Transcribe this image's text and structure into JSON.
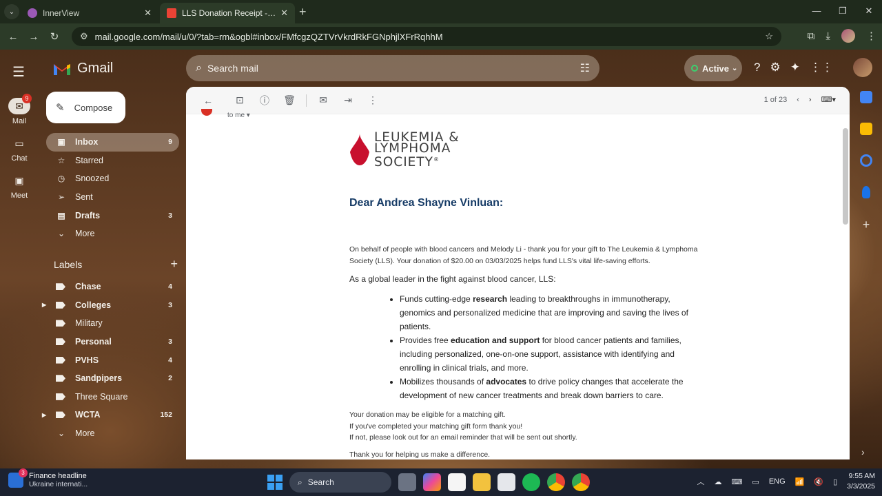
{
  "browser": {
    "tabs": [
      {
        "title": "InnerView"
      },
      {
        "title": "LLS Donation Receipt - andrea.s"
      }
    ],
    "url": "mail.google.com/mail/u/0/?tab=rm&ogbl#inbox/FMfcgzQZTVrVkrdRkFGNphjlXFrRqhhM"
  },
  "gmail": {
    "brand": "Gmail",
    "search_placeholder": "Search mail",
    "status": "Active",
    "rail": [
      {
        "label": "Mail",
        "badge": "9"
      },
      {
        "label": "Chat"
      },
      {
        "label": "Meet"
      }
    ],
    "compose": "Compose",
    "nav": [
      {
        "label": "Inbox",
        "count": "9"
      },
      {
        "label": "Starred",
        "count": ""
      },
      {
        "label": "Snoozed",
        "count": ""
      },
      {
        "label": "Sent",
        "count": ""
      },
      {
        "label": "Drafts",
        "count": "3"
      },
      {
        "label": "More",
        "count": ""
      }
    ],
    "labels_title": "Labels",
    "labels": [
      {
        "label": "Chase",
        "count": "4"
      },
      {
        "label": "Colleges",
        "count": "3"
      },
      {
        "label": "Military",
        "count": ""
      },
      {
        "label": "Personal",
        "count": "3"
      },
      {
        "label": "PVHS",
        "count": "4"
      },
      {
        "label": "Sandpipers",
        "count": "2"
      },
      {
        "label": "Three Square",
        "count": ""
      },
      {
        "label": "WCTA",
        "count": "152"
      },
      {
        "label": "More",
        "count": ""
      }
    ],
    "pager": "1 of 23"
  },
  "email": {
    "to": "to me",
    "org_name": "LEUKEMIA & LYMPHOMA SOCIETY",
    "org_line1": "LEUKEMIA &",
    "org_line2": "LYMPHOMA",
    "org_line3": "SOCIETY",
    "greeting": "Dear Andrea Shayne Vinluan:",
    "intro": "On behalf of people with blood cancers and Melody Li - thank you for your gift to The Leukemia & Lymphoma Society (LLS). Your donation of $20.00 on 03/03/2025 helps fund LLS's vital life-saving efforts.",
    "lead": "As a global leader in the fight against blood cancer, LLS:",
    "bullets": [
      {
        "pre": "Funds cutting-edge ",
        "bold": "research",
        "post": " leading to breakthroughs in immunotherapy, genomics and personalized medicine that are improving and saving the lives of patients."
      },
      {
        "pre": "Provides free ",
        "bold": "education and support",
        "post": " for blood cancer patients and families, including personalized, one-on-one support, assistance with identifying and enrolling in clinical trials, and more."
      },
      {
        "pre": "Mobilizes thousands of ",
        "bold": "advocates",
        "post": " to drive policy changes that accelerate the development of new cancer treatments and break down barriers to care."
      }
    ],
    "foot1": "Your donation may be eligible for a matching gift.",
    "foot2": "If you've completed your matching gift form thank you!",
    "foot3": "If not, please look out for an email reminder that will be sent out shortly.",
    "thanks": "Thank you for helping us make a difference."
  },
  "taskbar": {
    "news_title": "Finance headline",
    "news_sub": "Ukraine internati...",
    "news_badge": "3",
    "search": "Search",
    "lang": "ENG",
    "time": "9:55 AM",
    "date": "3/3/2025"
  }
}
